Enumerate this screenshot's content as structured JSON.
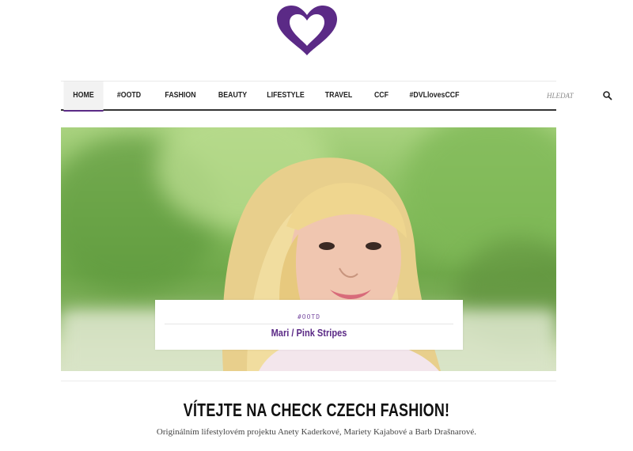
{
  "brand": {
    "logo_icon": "heart-logo-icon",
    "accent_color": "#5b2a86"
  },
  "nav": {
    "items": [
      {
        "label": "HOME",
        "active": true
      },
      {
        "label": "#OOTD",
        "active": false
      },
      {
        "label": "FASHION",
        "active": false
      },
      {
        "label": "BEAUTY",
        "active": false
      },
      {
        "label": "LIFESTYLE",
        "active": false
      },
      {
        "label": "TRAVEL",
        "active": false
      },
      {
        "label": "CCF",
        "active": false
      },
      {
        "label": "#DVLlovesCCF",
        "active": false
      }
    ],
    "search": {
      "placeholder": "HLEDAT",
      "icon": "search-icon"
    }
  },
  "hero": {
    "category": "#OOTD",
    "title": "Mari / Pink Stripes"
  },
  "welcome": {
    "heading": "VÍTEJTE NA CHECK CZECH FASHION!",
    "tagline": "Originálním lifestylovém projektu Anety Kaderkové, Mariety Kajabové a Barb Drašnarové."
  }
}
